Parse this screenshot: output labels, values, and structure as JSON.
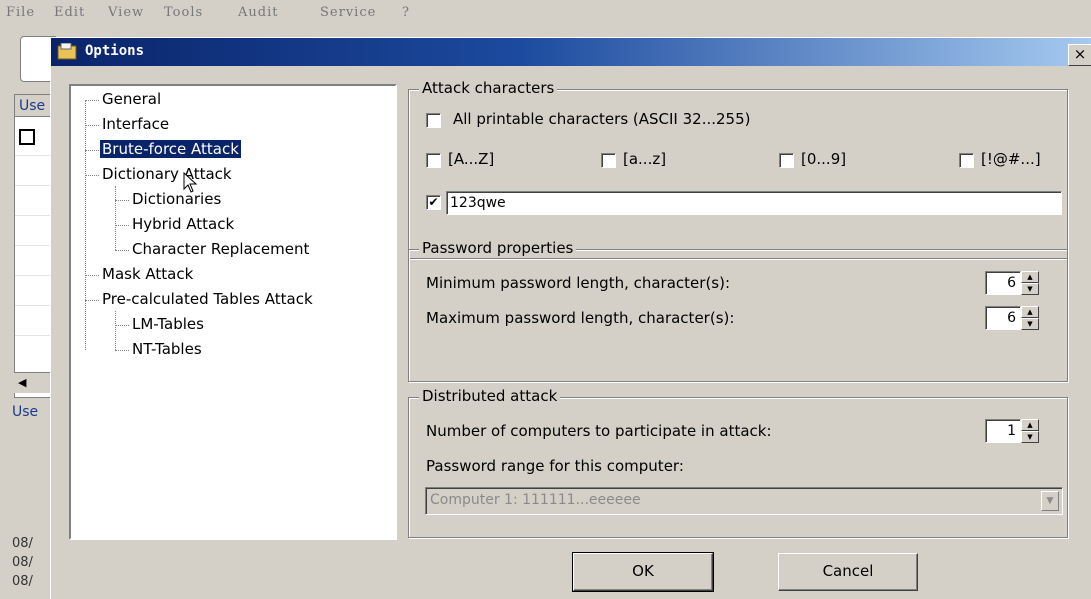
{
  "menubar": {
    "items": [
      "File",
      "Edit",
      "View",
      "Tools",
      "Audit",
      "Service",
      "?"
    ]
  },
  "background": {
    "grid_header": "Use",
    "left_label": "Use",
    "log_lines": [
      "08/",
      "08/",
      "08/"
    ]
  },
  "dialog": {
    "title": "Options",
    "close_label": "×",
    "tree": {
      "items": [
        {
          "label": "General",
          "level": 0
        },
        {
          "label": "Interface",
          "level": 0
        },
        {
          "label": "Brute-force Attack",
          "level": 0,
          "selected": true
        },
        {
          "label": "Dictionary Attack",
          "level": 0
        },
        {
          "label": "Dictionaries",
          "level": 1
        },
        {
          "label": "Hybrid Attack",
          "level": 1
        },
        {
          "label": "Character Replacement",
          "level": 1
        },
        {
          "label": "Mask Attack",
          "level": 0
        },
        {
          "label": "Pre-calculated Tables Attack",
          "level": 0
        },
        {
          "label": "LM-Tables",
          "level": 1
        },
        {
          "label": "NT-Tables",
          "level": 1
        }
      ]
    },
    "attack_characters": {
      "legend": "Attack characters",
      "all_printable": {
        "label": "All printable characters (ASCII 32...255)",
        "checked": false
      },
      "upper": {
        "label": "[A...Z]",
        "checked": false
      },
      "lower": {
        "label": "[a...z]",
        "checked": false
      },
      "digits": {
        "label": "[0...9]",
        "checked": false
      },
      "special": {
        "label": "[!@#...]",
        "checked": false
      },
      "custom": {
        "checked": true,
        "value": "123qwe"
      }
    },
    "password_properties": {
      "legend": "Password properties",
      "min_label": "Minimum password length, character(s):",
      "min_value": "6",
      "max_label": "Maximum password length, character(s):",
      "max_value": "6"
    },
    "distributed_attack": {
      "legend": "Distributed attack",
      "computers_label": "Number of computers to participate in attack:",
      "computers_value": "1",
      "range_label": "Password range for this computer:",
      "range_value": "Computer 1: 111111...eeeeee"
    },
    "buttons": {
      "ok": "OK",
      "cancel": "Cancel"
    }
  }
}
